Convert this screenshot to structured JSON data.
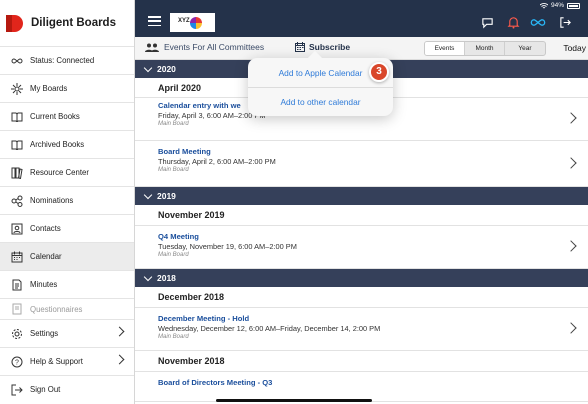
{
  "sidebar": {
    "brand": "Diligent Boards",
    "items": [
      {
        "label": "Status: Connected",
        "icon": "infinity-icon"
      },
      {
        "label": "My Boards",
        "icon": "boards-icon"
      },
      {
        "label": "Current Books",
        "icon": "book-icon"
      },
      {
        "label": "Archived Books",
        "icon": "archive-book-icon"
      },
      {
        "label": "Resource Center",
        "icon": "resource-icon"
      },
      {
        "label": "Nominations",
        "icon": "nominations-icon"
      },
      {
        "label": "Contacts",
        "icon": "contacts-icon"
      },
      {
        "label": "Calendar",
        "icon": "calendar-icon"
      },
      {
        "label": "Minutes",
        "icon": "minutes-icon"
      },
      {
        "label": "Questionnaires",
        "icon": "questionnaire-icon"
      },
      {
        "label": "Settings",
        "icon": "gear-icon"
      },
      {
        "label": "Help & Support",
        "icon": "help-icon"
      },
      {
        "label": "Sign Out",
        "icon": "sign-out-icon"
      }
    ]
  },
  "header": {
    "org_logo_text": "XYZ",
    "battery": "94%"
  },
  "toolbar": {
    "events_for": "Events For All Committees",
    "subscribe": "Subscribe",
    "views": [
      "Events",
      "Month",
      "Year"
    ],
    "selected_view": "Events",
    "today": "Today"
  },
  "popover": {
    "option1": "Add to Apple Calendar",
    "option2": "Add to other calendar",
    "step": "3"
  },
  "calendar": {
    "years": [
      {
        "year": "2020",
        "months": [
          {
            "month": "April 2020",
            "events": [
              {
                "title": "Calendar entry with we",
                "time": "Friday, April 3, 6:00 AM–2:00 PM",
                "board": "Main Board"
              },
              {
                "title": "Board Meeting",
                "time": "Thursday, April 2, 6:00 AM–2:00 PM",
                "board": "Main Board"
              }
            ]
          }
        ]
      },
      {
        "year": "2019",
        "months": [
          {
            "month": "November 2019",
            "events": [
              {
                "title": "Q4 Meeting",
                "time": "Tuesday, November 19, 6:00 AM–2:00 PM",
                "board": "Main Board"
              }
            ]
          }
        ]
      },
      {
        "year": "2018",
        "months": [
          {
            "month": "December 2018",
            "events": [
              {
                "title": "December Meeting - Hold",
                "time": "Wednesday, December 12, 6:00 AM–Friday, December 14, 2:00 PM",
                "board": "Main Board"
              }
            ]
          },
          {
            "month": "November 2018",
            "events": [
              {
                "title": "Board of Directors Meeting - Q3",
                "time": "",
                "board": ""
              }
            ]
          }
        ]
      }
    ]
  },
  "colors": {
    "header_bg": "#24324a",
    "year_bar": "#35405a",
    "link_blue": "#1a4e9c",
    "ios_blue": "#2f7bd8",
    "brand_red": "#e1251b",
    "badge": "#d9472b",
    "accent_cyan": "#29b6f6"
  }
}
